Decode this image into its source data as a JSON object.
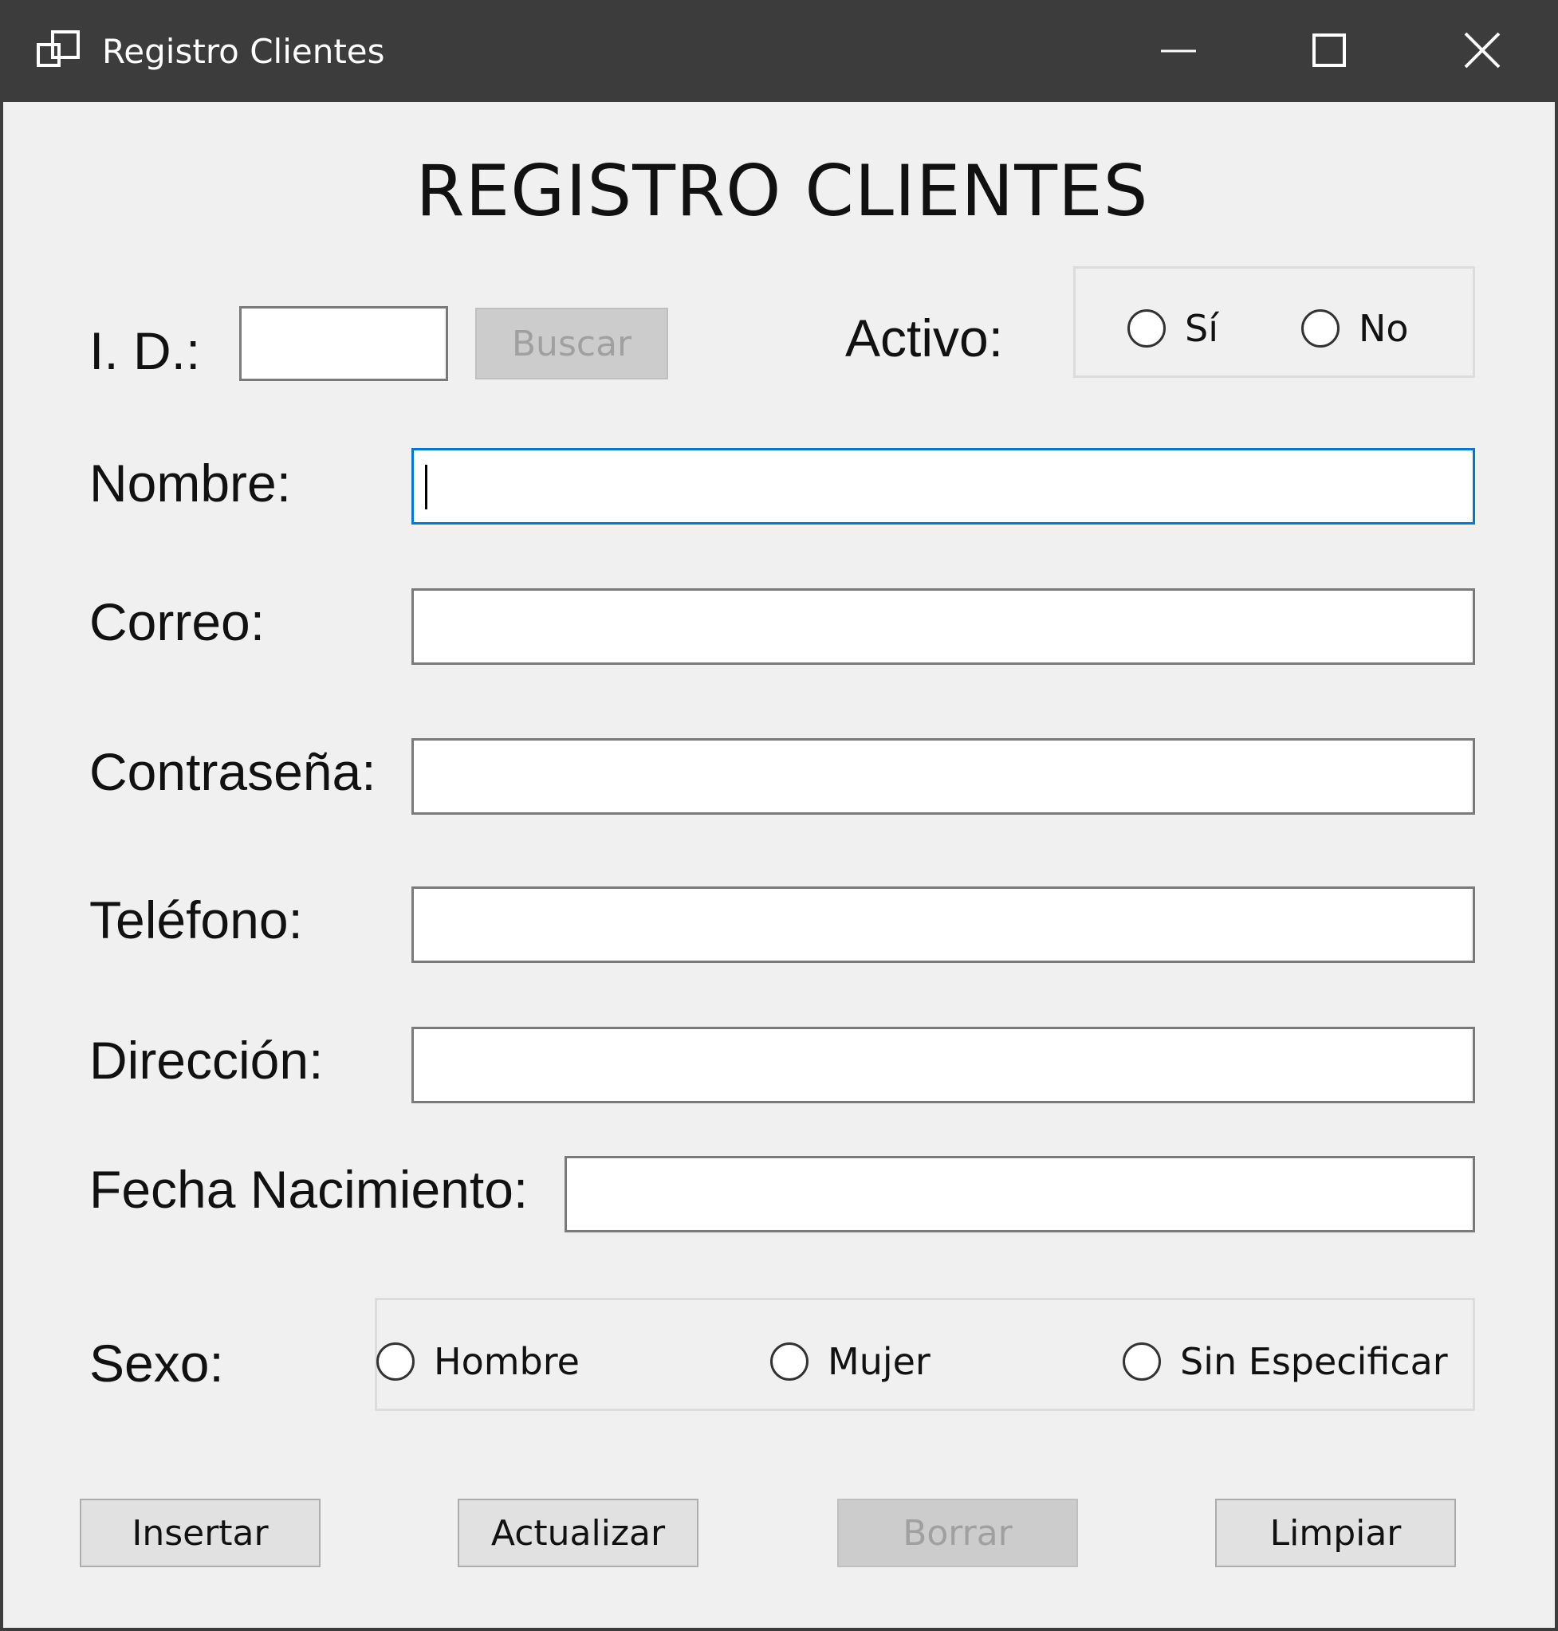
{
  "window": {
    "title": "Registro Clientes",
    "controls": [
      "minimize-icon",
      "maximize-icon",
      "close-icon"
    ]
  },
  "form": {
    "heading": "REGISTRO CLIENTES",
    "id_label": "I. D.:",
    "id_value": "",
    "search_button": "Buscar",
    "active_label": "Activo:",
    "active_options": [
      "Sí",
      "No"
    ],
    "fields": {
      "nombre": {
        "label": "Nombre:",
        "value": ""
      },
      "correo": {
        "label": "Correo:",
        "value": ""
      },
      "contrasena": {
        "label": "Contraseña:",
        "value": ""
      },
      "telefono": {
        "label": "Teléfono:",
        "value": ""
      },
      "direccion": {
        "label": "Dirección:",
        "value": ""
      },
      "fecha": {
        "label": "Fecha Nacimiento:",
        "value": ""
      }
    },
    "sex_label": "Sexo:",
    "sex_options": [
      "Hombre",
      "Mujer",
      "Sin Especificar"
    ]
  },
  "buttons": {
    "insert": "Insertar",
    "update": "Actualizar",
    "delete": "Borrar",
    "clear": "Limpiar"
  },
  "colors": {
    "titlebar": "#3c3c3c",
    "window_bg": "#f0f0f0",
    "focus_border": "#0078d7",
    "disabled_button": "#cccccc"
  }
}
